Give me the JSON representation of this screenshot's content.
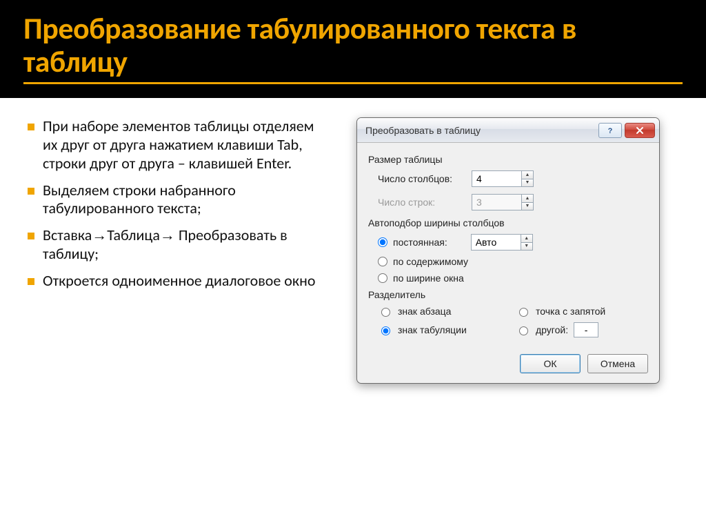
{
  "title": "Преобразование табулированного текста в таблицу",
  "bullets": [
    "При наборе элементов таблицы отделяем их друг от друга нажатием клавиши Tab, строки друг от друга – клавишей Enter.",
    "Выделяем строки набранного табулированного текста;",
    {
      "a": "Вставка",
      "b": "Таблица",
      "c": "Преобразовать в таблицу;"
    },
    "Откроется одноименное диалоговое окно"
  ],
  "dialog": {
    "title": "Преобразовать в таблицу",
    "groups": {
      "size": "Размер таблицы",
      "autofit": "Автоподбор ширины столбцов",
      "separator": "Разделитель"
    },
    "labels": {
      "columns": "Число столбцов:",
      "rows": "Число строк:"
    },
    "values": {
      "columns": "4",
      "rows": "3",
      "width": "Авто",
      "other_sep": "-"
    },
    "autofit": {
      "fixed": "постоянная:",
      "contents": "по содержимому",
      "window": "по ширине окна"
    },
    "sep": {
      "paragraph": "знак абзаца",
      "semicolon": "точка с запятой",
      "tab": "знак табуляции",
      "other": "другой:"
    },
    "buttons": {
      "ok": "ОК",
      "cancel": "Отмена"
    }
  }
}
